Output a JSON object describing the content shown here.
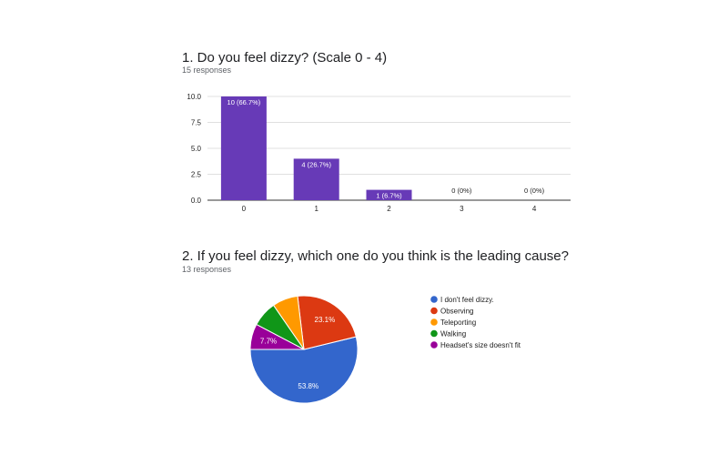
{
  "questions": [
    {
      "title": "1. Do you feel dizzy?  (Scale 0 - 4)",
      "responses": "15 responses"
    },
    {
      "title": "2. If you feel dizzy, which one do you think is the leading cause?",
      "responses": "13 responses"
    }
  ],
  "chart_data": [
    {
      "type": "bar",
      "title": "1. Do you feel dizzy?  (Scale 0 - 4)",
      "categories": [
        "0",
        "1",
        "2",
        "3",
        "4"
      ],
      "values": [
        10,
        4,
        1,
        0,
        0
      ],
      "data_labels": [
        "10 (66.7%)",
        "4 (26.7%)",
        "1 (6.7%)",
        "0 (0%)",
        "0 (0%)"
      ],
      "ylim": [
        0,
        10
      ],
      "yticks": [
        "0.0",
        "2.5",
        "5.0",
        "7.5",
        "10.0"
      ],
      "grid": true,
      "bar_color": "#673ab7"
    },
    {
      "type": "pie",
      "title": "2. If you feel dizzy, which one do you think is the leading cause?",
      "legend_position": "right",
      "slices": [
        {
          "label": "I don't feel dizzy.",
          "value": 53.8,
          "display": "53.8%",
          "color": "#3366cc"
        },
        {
          "label": "Observing",
          "value": 23.1,
          "display": "23.1%",
          "color": "#dc3912"
        },
        {
          "label": "Teleporting",
          "value": 7.7,
          "display": "",
          "color": "#ff9900"
        },
        {
          "label": "Walking",
          "value": 7.7,
          "display": "",
          "color": "#109618"
        },
        {
          "label": "Headset's size doesn't fit",
          "value": 7.7,
          "display": "7.7%",
          "color": "#990099"
        }
      ]
    }
  ]
}
